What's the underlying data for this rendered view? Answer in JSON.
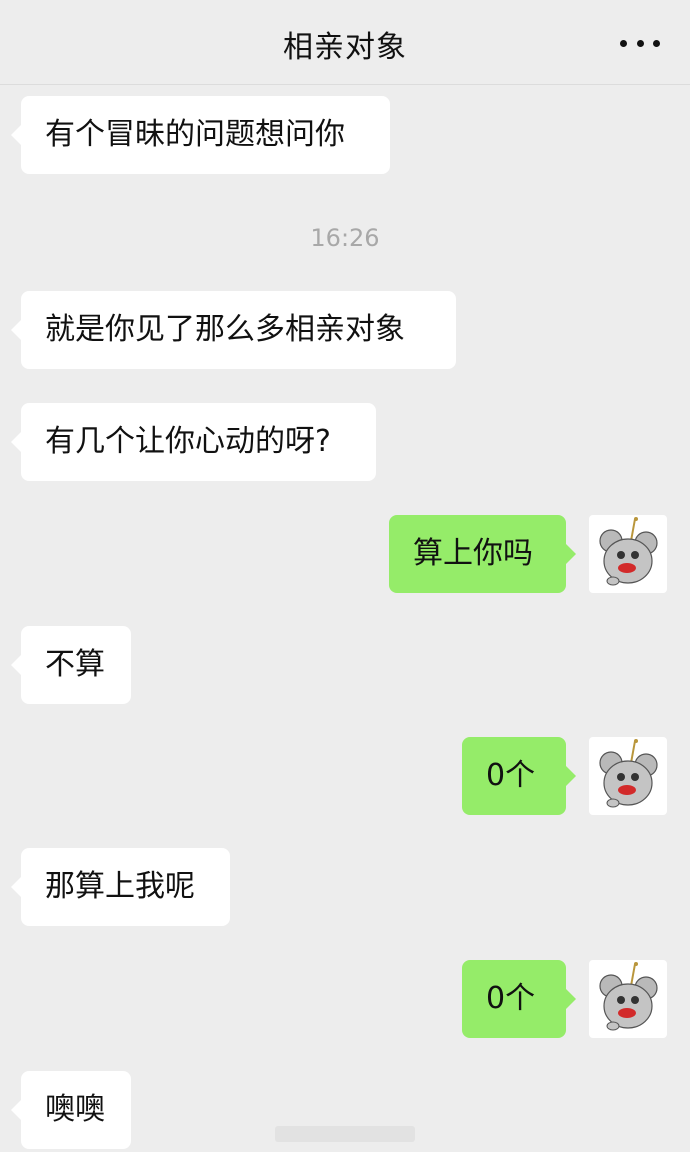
{
  "header": {
    "title": "相亲对象",
    "more_icon": "more-dots-icon"
  },
  "timestamp": "16:26",
  "messages": [
    {
      "side": "in",
      "text": "有个冒昧的问题想问你"
    },
    {
      "side": "in",
      "text": "就是你见了那么多相亲对象"
    },
    {
      "side": "in",
      "text": "有几个让你心动的呀?"
    },
    {
      "side": "out",
      "text": "算上你吗"
    },
    {
      "side": "in",
      "text": "不算"
    },
    {
      "side": "out",
      "text": "0个"
    },
    {
      "side": "in",
      "text": "那算上我呢"
    },
    {
      "side": "out",
      "text": "0个"
    },
    {
      "side": "in",
      "text": "噢噢"
    }
  ],
  "colors": {
    "background": "#ededed",
    "incoming_bubble": "#ffffff",
    "outgoing_bubble": "#95ec69"
  },
  "avatar_icon": "mouse-sticker-avatar-icon"
}
